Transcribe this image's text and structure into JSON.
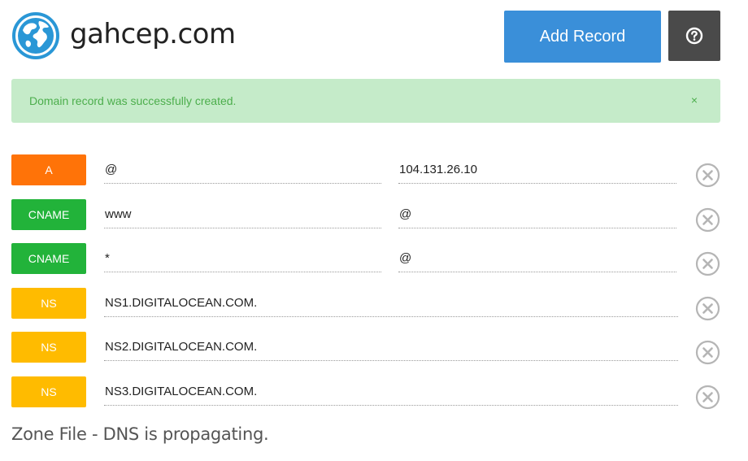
{
  "header": {
    "logo_icon": "globe-icon",
    "domain": "gahcep.com",
    "add_record_label": "Add Record",
    "help_icon": "question-circle-icon"
  },
  "alert": {
    "message": "Domain record was successfully created.",
    "close_label": "×"
  },
  "records": [
    {
      "type": "A",
      "color": "#ff7308",
      "name": "@",
      "value": "104.131.26.10"
    },
    {
      "type": "CNAME",
      "color": "#22b33a",
      "name": "www",
      "value": "@"
    },
    {
      "type": "CNAME",
      "color": "#22b33a",
      "name": "*",
      "value": "@"
    },
    {
      "type": "NS",
      "color": "#ffbb00",
      "name": "NS1.DIGITALOCEAN.COM.",
      "value": null
    },
    {
      "type": "NS",
      "color": "#ffbb00",
      "name": "NS2.DIGITALOCEAN.COM.",
      "value": null
    },
    {
      "type": "NS",
      "color": "#ffbb00",
      "name": "NS3.DIGITALOCEAN.COM.",
      "value": null
    }
  ],
  "footer": {
    "status": "Zone File - DNS is propagating."
  },
  "colors": {
    "primary": "#3a8fd9",
    "alert_bg": "#c5ebc9",
    "alert_text": "#4cae4c"
  }
}
